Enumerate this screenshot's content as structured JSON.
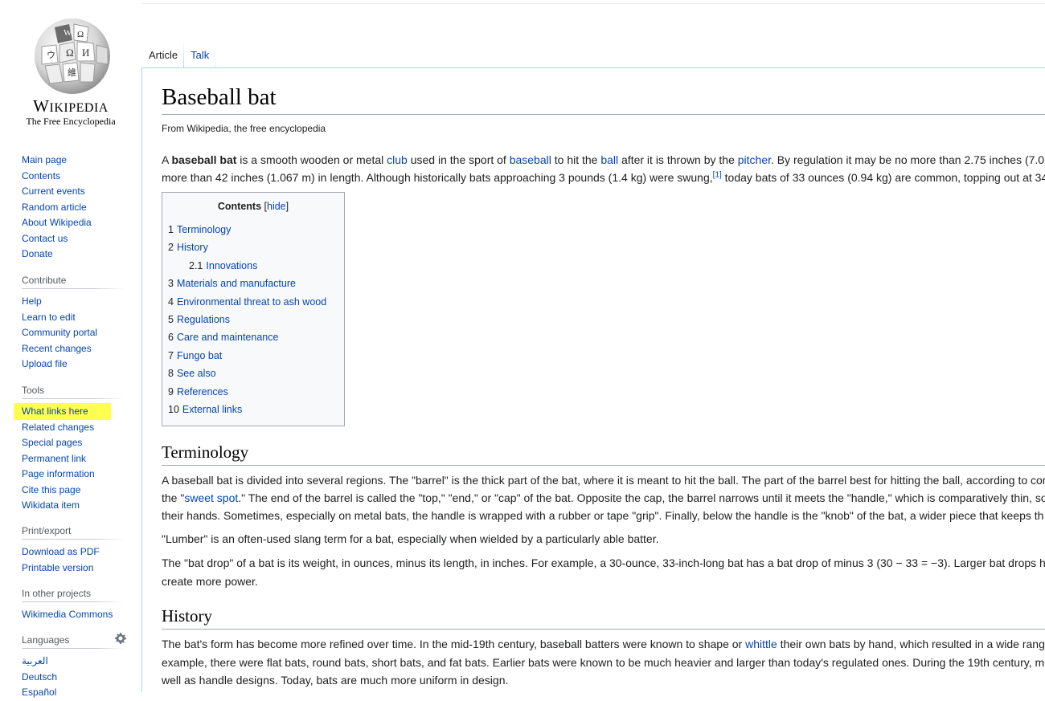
{
  "logo": {
    "wordmark_first": "W",
    "wordmark_rest": "IKIPEDIA",
    "tagline": "The Free Encyclopedia"
  },
  "navigation": {
    "items": [
      "Main page",
      "Contents",
      "Current events",
      "Random article",
      "About Wikipedia",
      "Contact us",
      "Donate"
    ]
  },
  "contribute": {
    "heading": "Contribute",
    "items": [
      "Help",
      "Learn to edit",
      "Community portal",
      "Recent changes",
      "Upload file"
    ]
  },
  "tools": {
    "heading": "Tools",
    "items": [
      "What links here",
      "Related changes",
      "Special pages",
      "Permanent link",
      "Page information",
      "Cite this page",
      "Wikidata item"
    ],
    "highlight_color": "#ffff52"
  },
  "print_export": {
    "heading": "Print/export",
    "items": [
      "Download as PDF",
      "Printable version"
    ]
  },
  "other_projects": {
    "heading": "In other projects",
    "items": [
      "Wikimedia Commons"
    ]
  },
  "languages": {
    "heading": "Languages",
    "icon": "gear-icon",
    "items": [
      "العربية",
      "Deutsch",
      "Español"
    ]
  },
  "tabs": [
    "Article",
    "Talk"
  ],
  "article": {
    "title": "Baseball bat",
    "subtitle": "From Wikipedia, the free encyclopedia",
    "intro": {
      "l1_a": "A ",
      "l1_bold": "baseball bat",
      "l1_b": " is a smooth wooden or metal ",
      "l1_link1": "club",
      "l1_c": " used in the sport of ",
      "l1_link2": "baseball",
      "l1_d": " to hit the ",
      "l1_link3": "ball",
      "l1_e": " after it is thrown by the ",
      "l1_link4": "pitcher",
      "l1_f": ". By regulation it may be no more than 2.75 inches (7.0",
      "l2_a": "more than 42 inches (1.067 m) in length. Although historically bats approaching 3 pounds (1.4 kg) were swung,",
      "l2_ref": "[1]",
      "l2_b": " today bats of 33 ounces (0.94 kg) are common, topping out at 34"
    },
    "toc": {
      "title": "Contents",
      "toggle_open": "[",
      "toggle": "hide",
      "toggle_close": "]",
      "items": [
        {
          "num": "1",
          "label": "Terminology"
        },
        {
          "num": "2",
          "label": "History"
        },
        {
          "num": "2.1",
          "label": "Innovations"
        },
        {
          "num": "3",
          "label": "Materials and manufacture"
        },
        {
          "num": "4",
          "label": "Environmental threat to ash wood"
        },
        {
          "num": "5",
          "label": "Regulations"
        },
        {
          "num": "6",
          "label": "Care and maintenance"
        },
        {
          "num": "7",
          "label": "Fungo bat"
        },
        {
          "num": "8",
          "label": "See also"
        },
        {
          "num": "9",
          "label": "References"
        },
        {
          "num": "10",
          "label": "External links"
        }
      ]
    },
    "terminology": {
      "heading": "Terminology",
      "p1_l1": "A baseball bat is divided into several regions. The \"barrel\" is the thick part of the bat, where it is meant to hit the ball. The part of the barrel best for hitting the ball, according to cor",
      "p1_l2_a": "the \"",
      "p1_l2_link": "sweet spot",
      "p1_l2_b": ".\" The end of the barrel is called the \"top,\" \"end,\" or \"cap\" of the bat. Opposite the cap, the barrel narrows until it meets the \"handle,\" which is comparatively thin, so",
      "p1_l3": "their hands. Sometimes, especially on metal bats, the handle is wrapped with a rubber or tape \"grip\". Finally, below the handle is the \"knob\" of the bat, a wider piece that keeps th",
      "p2": "\"Lumber\" is an often-used slang term for a bat, especially when wielded by a particularly able batter.",
      "p3_l1": "The \"bat drop\" of a bat is its weight, in ounces, minus its length, in inches. For example, a 30-ounce, 33-inch-long bat has a bat drop of minus 3 (30 − 33 = −3). Larger bat drops h",
      "p3_l2": "create more power."
    },
    "history": {
      "heading": "History",
      "l1_a": "The bat's form has become more refined over time. In the mid-19th century, baseball batters were known to shape or ",
      "l1_link": "whittle",
      "l1_b": " their own bats by hand, which resulted in a wide rang",
      "l2": "example, there were flat bats, round bats, short bats, and fat bats. Earlier bats were known to be much heavier and larger than today's regulated ones. During the 19th century, m",
      "l3": "well as handle designs. Today, bats are much more uniform in design."
    }
  }
}
